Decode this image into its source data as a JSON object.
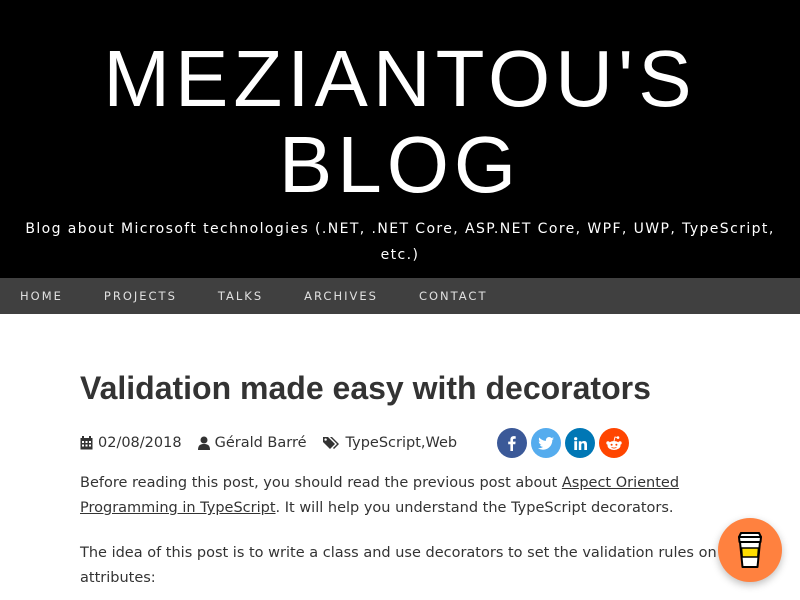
{
  "header": {
    "title_line1": "MEZIANTOU'S",
    "title_line2": "BLOG",
    "tagline": "Blog about Microsoft technologies (.NET, .NET Core, ASP.NET Core, WPF, UWP, TypeScript, etc.)"
  },
  "nav": {
    "items": [
      {
        "label": "HOME"
      },
      {
        "label": "PROJECTS"
      },
      {
        "label": "TALKS"
      },
      {
        "label": "ARCHIVES"
      },
      {
        "label": "CONTACT"
      }
    ]
  },
  "post": {
    "title": "Validation made easy with decorators",
    "date": "02/08/2018",
    "author": "Gérald Barré",
    "tags": [
      "TypeScript",
      "Web"
    ],
    "tag_separator": ", ",
    "paragraph1": {
      "before": "Before reading this post, you should read the previous post about ",
      "link": "Aspect Oriented Programming in TypeScript",
      "after": ". It will help you understand the TypeScript decorators."
    },
    "paragraph2": "The idea of this post is to write a class and use decorators to set the validation rules on attributes:"
  },
  "share": {
    "icons": [
      "facebook-icon",
      "twitter-icon",
      "linkedin-icon",
      "reddit-icon"
    ],
    "colors": {
      "facebook": "#3b5998",
      "twitter": "#55acee",
      "linkedin": "#0077b5",
      "reddit": "#ff4500"
    }
  },
  "coffee_button": {
    "icon": "coffee-cup-icon",
    "color": "#ff813f"
  }
}
